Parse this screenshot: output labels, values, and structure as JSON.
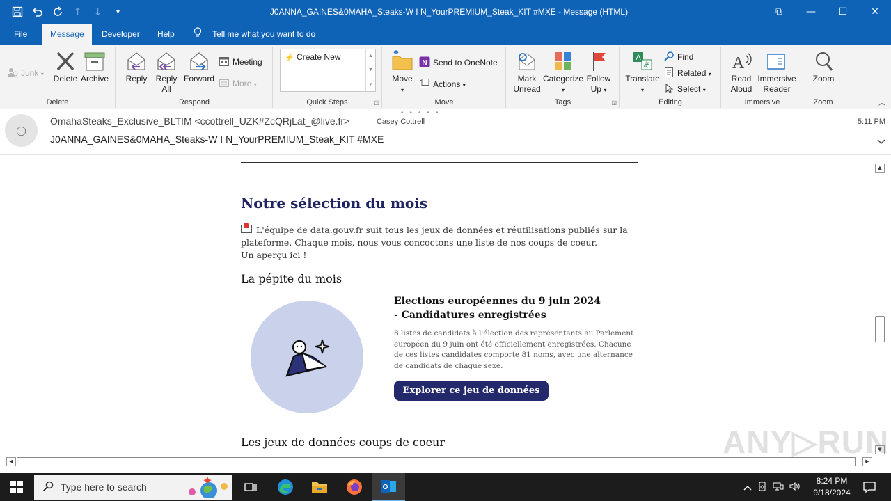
{
  "titlebar": {
    "title": "J0ANNA_GAINES&0MAHA_Steaks-W I N_YourPREMIUM_Steak_KIT  #MXE  -  Message (HTML)",
    "qat": {
      "save": "💾",
      "undo": "↶",
      "redo": "↻",
      "up": "↑",
      "down": "↓",
      "customize": "▾"
    },
    "window": {
      "restore_ribbon": "⧉",
      "minimize": "—",
      "maximize": "☐",
      "close": "✕"
    }
  },
  "tabs": {
    "file": "File",
    "message": "Message",
    "developer": "Developer",
    "help": "Help",
    "tellme": "Tell me what you want to do"
  },
  "ribbon": {
    "delete_group": {
      "label": "Delete",
      "junk": "Junk",
      "delete": "Delete",
      "archive": "Archive"
    },
    "respond_group": {
      "label": "Respond",
      "reply": "Reply",
      "reply_all_1": "Reply",
      "reply_all_2": "All",
      "forward": "Forward",
      "meeting": "Meeting",
      "more": "More"
    },
    "quicksteps_group": {
      "label": "Quick Steps",
      "create_new": "Create New"
    },
    "move_group": {
      "label": "Move",
      "move": "Move",
      "onenote": "Send to OneNote",
      "actions": "Actions"
    },
    "tags_group": {
      "label": "Tags",
      "mark_unread_1": "Mark",
      "mark_unread_2": "Unread",
      "categorize": "Categorize",
      "follow_up_1": "Follow",
      "follow_up_2": "Up"
    },
    "editing_group": {
      "label": "Editing",
      "translate": "Translate",
      "find": "Find",
      "related": "Related",
      "select": "Select"
    },
    "immersive_group": {
      "label": "Immersive",
      "read_aloud_1": "Read",
      "read_aloud_2": "Aloud",
      "immersive_reader_1": "Immersive",
      "immersive_reader_2": "Reader"
    },
    "zoom_group": {
      "label": "Zoom",
      "zoom": "Zoom"
    }
  },
  "message": {
    "avatar": "◯",
    "from": "OmahaSteaks_Exclusive_BLTIM <ccottrell_UZK#ZcQRjLat_@live.fr>",
    "to": "Casey Cottrell",
    "subject": "J0ANNA_GAINES&0MAHA_Steaks-W I N_YourPREMIUM_Steak_KIT  #MXE",
    "time": "5:11 PM"
  },
  "email": {
    "heading": "Notre sélection du mois",
    "intro": "L'équipe de data.gouv.fr suit tous les jeux de données et réutilisations publiés sur la plateforme. Chaque mois, nous vous concoctons une liste de nos coups de coeur.",
    "intro2": "Un aperçu ici !",
    "nugget_heading": "La pépite du mois",
    "card_title": "Elections européennes du 9 juin 2024 - Candidatures enregistrées",
    "card_desc": "8 listes de candidats à l'élection des représentants au Parlement européen du 9 juin ont été officiellement enregistrées. Chacune de ces listes candidates comporte  81 noms, avec une alternance de candidats de chaque sexe.",
    "cta": "Explorer  ce jeu  de  données",
    "favorites_heading": "Les jeux de données coups de coeur"
  },
  "watermark": "ANY▷RUN",
  "taskbar": {
    "search_placeholder": "Type here to search",
    "time": "8:24 PM",
    "date": "9/18/2024"
  },
  "colors": {
    "titlebar": "#0f63b6",
    "ribbon_bg": "#f3f3f3",
    "email_heading": "#1f2560",
    "cta_bg": "#23296a",
    "circle_bg": "#c9d2ea",
    "taskbar": "#1c1c1c"
  }
}
